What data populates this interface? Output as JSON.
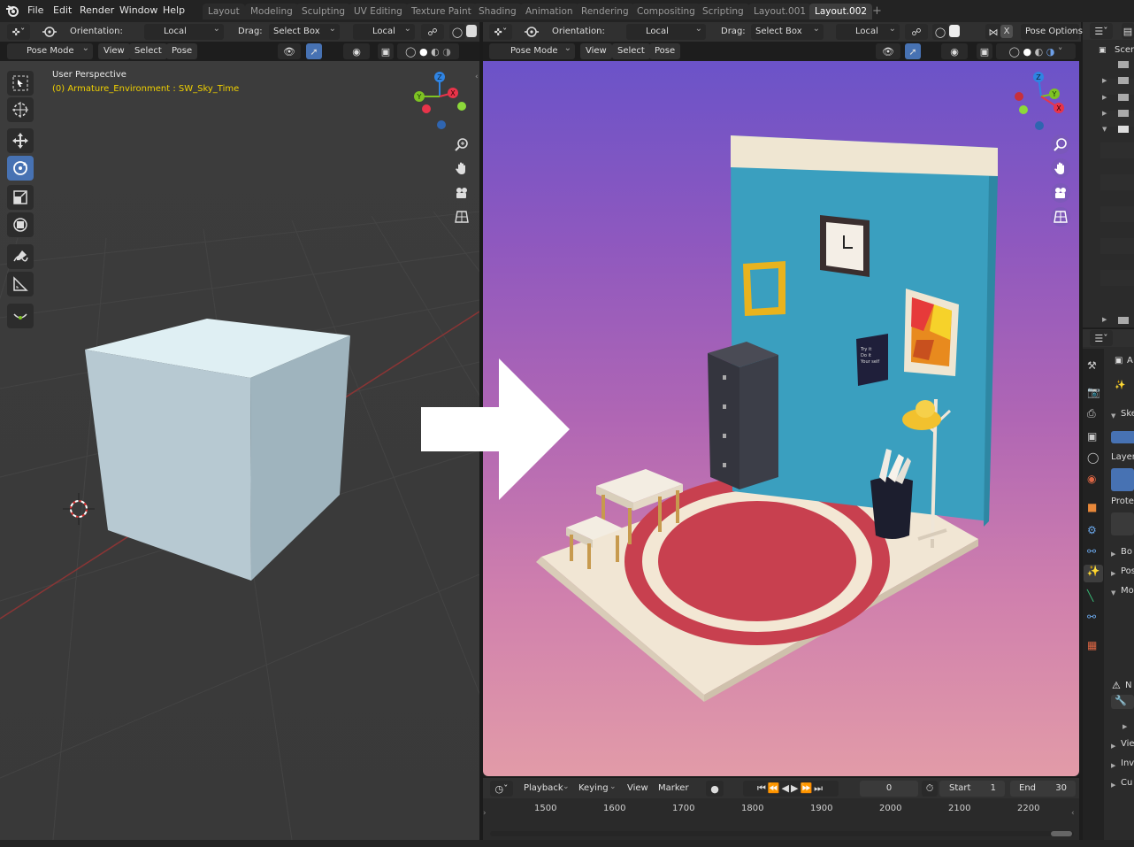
{
  "menu": [
    "File",
    "Edit",
    "Render",
    "Window",
    "Help"
  ],
  "workspaces": [
    {
      "label": "Layout",
      "active": false
    },
    {
      "label": "Modeling",
      "active": false
    },
    {
      "label": "Sculpting",
      "active": false
    },
    {
      "label": "UV Editing",
      "active": false
    },
    {
      "label": "Texture Paint",
      "active": false
    },
    {
      "label": "Shading",
      "active": false
    },
    {
      "label": "Animation",
      "active": false
    },
    {
      "label": "Rendering",
      "active": false
    },
    {
      "label": "Compositing",
      "active": false
    },
    {
      "label": "Scripting",
      "active": false
    },
    {
      "label": "Layout.001",
      "active": false
    },
    {
      "label": "Layout.002",
      "active": true
    }
  ],
  "add_workspace": "+",
  "left_header": {
    "orientation_label": "Orientation:",
    "orientation_value": "Local",
    "drag_label": "Drag:",
    "drag_value": "Select Box",
    "pivot_value": "Local",
    "mode": "Pose Mode",
    "view": "View",
    "select": "Select",
    "pose": "Pose"
  },
  "right_header": {
    "orientation_label": "Orientation:",
    "orientation_value": "Local",
    "drag_label": "Drag:",
    "drag_value": "Select Box",
    "pivot_value": "Local",
    "pose_options": "Pose Options",
    "x_label": "X",
    "mode": "Pose Mode",
    "view": "View",
    "select": "Select",
    "pose": "Pose"
  },
  "viewport_left": {
    "title": "User Perspective",
    "subtitle": "(0) Armature_Environment : SW_Sky_Time"
  },
  "gizmo": {
    "x": "X",
    "y": "Y",
    "z": "Z"
  },
  "poster_text": "Try it\nDo it\nYour self",
  "timeline": {
    "playback": "Playback",
    "keying": "Keying",
    "view": "View",
    "marker": "Marker",
    "current_frame": "0",
    "start_label": "Start",
    "start_value": "1",
    "end_label": "End",
    "end_value": "30",
    "frames": [
      "1500",
      "1600",
      "1700",
      "1800",
      "1900",
      "2000",
      "2100",
      "2200"
    ]
  },
  "outliner": {
    "scene_label": "Scer"
  },
  "properties": {
    "skeleton": "Ske",
    "layers": "Layer",
    "protected": "Protec",
    "bone_groups": "Bo",
    "pose_library": "Pos",
    "motion_paths": "Mo",
    "n_label": "N",
    "viewport_display": "Vie",
    "inverse_kinematics": "Inv",
    "custom_properties": "Cu",
    "a_label": "A"
  },
  "colors": {
    "accent": "#4772b3",
    "header_bg": "#303030",
    "viewport_bg": "#3a3a3a",
    "subtitle": "#f0d000",
    "gizmo_x": "#e8344a",
    "gizmo_y": "#7ec323",
    "gizmo_z": "#2f84e3",
    "wall": "#3a9fbf",
    "rug": "#c8404f"
  },
  "icons": [
    "blender-logo",
    "select-box-icon",
    "cursor-icon",
    "move-icon",
    "rotate-icon",
    "scale-icon",
    "transform-icon",
    "annotate-icon",
    "measure-icon",
    "bone-roll-icon",
    "zoom-icon",
    "hand-icon",
    "camera-icon",
    "grid-view-icon"
  ]
}
